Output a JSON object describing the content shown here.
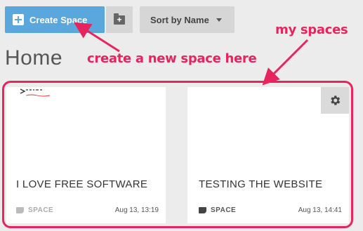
{
  "toolbar": {
    "create_label": "Create Space",
    "sort_label": "Sort by Name"
  },
  "page": {
    "title": "Home"
  },
  "annotations": {
    "create_hint": "create a new space here",
    "spaces_hint": "my spaces"
  },
  "spaces": [
    {
      "title": "I LOVE FREE SOFTWARE",
      "type": "SPACE",
      "date": "Aug 13, 13:19",
      "thumbnail_text": "",
      "thumbnail_subtext": ""
    },
    {
      "title": "TESTING THE WEBSITE",
      "type": "SPACE",
      "date": "Aug 13, 14:41"
    }
  ],
  "colors": {
    "accent": "#5aa7dd",
    "annotation": "#e8245e",
    "background": "#ececec"
  },
  "icons": [
    "plus-icon",
    "folder-plus-icon",
    "chevron-down-icon",
    "tag-icon",
    "gear-icon"
  ]
}
